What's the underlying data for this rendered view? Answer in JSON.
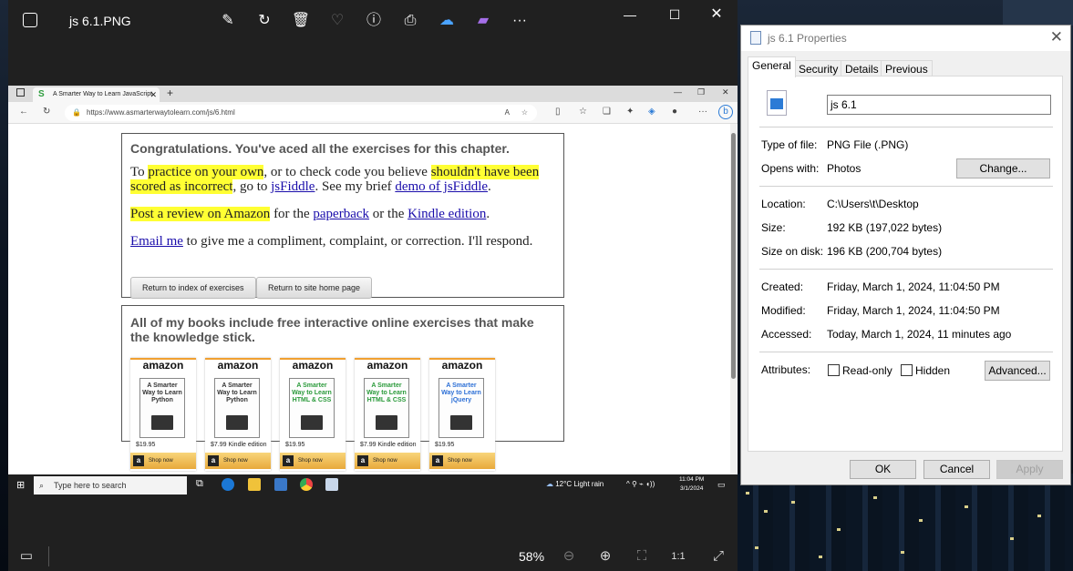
{
  "photos": {
    "title": "js 6.1.PNG",
    "zoom": "58%"
  },
  "browser": {
    "tab_title": "A Smarter Way to Learn JavaScript",
    "url": "https://www.asmarterwaytolearn.com/js/6.html"
  },
  "page": {
    "heading": "Congratulations. You've aced all the exercises for this chapter.",
    "p1": {
      "to": "To ",
      "hl1": "practice on your own",
      "mid": ", or to check code you believe ",
      "hl2": "shouldn't have been scored as incorrect",
      "go": ", go to ",
      "link1": "jsFiddle",
      "brief": ". See my brief ",
      "link2": "demo of jsFiddle",
      "end": "."
    },
    "p2": {
      "hl": "Post a review on Amazon",
      "for": " for the ",
      "link1": "paperback",
      "or": " or the ",
      "link2": "Kindle edition",
      "end": "."
    },
    "p3": {
      "link": "Email me",
      "rest": " to give me a compliment, complaint, or correction. I'll respond."
    },
    "btn_index": "Return to index of exercises",
    "btn_home": "Return to site home page",
    "books_heading": "All of my books include free interactive online exercises that make the knowledge stick.",
    "books": [
      {
        "brand": "amazon",
        "title": "A Smarter Way to Learn Python",
        "price": "$19.95",
        "shop": "Shop now",
        "color": "#333333"
      },
      {
        "brand": "amazon",
        "title": "A Smarter Way to Learn Python",
        "price": "$7.99 Kindle edition",
        "shop": "Shop now",
        "color": "#333333"
      },
      {
        "brand": "amazon",
        "title": "A Smarter Way to Learn HTML & CSS",
        "price": "$19.95",
        "shop": "Shop now",
        "color": "#2a9a3a"
      },
      {
        "brand": "amazon",
        "title": "A Smarter Way to Learn HTML & CSS",
        "price": "$7.99 Kindle edition",
        "shop": "Shop now",
        "color": "#2a9a3a"
      },
      {
        "brand": "amazon",
        "title": "A Smarter Way to Learn jQuery",
        "price": "$19.95",
        "shop": "Shop now",
        "color": "#2c6fd6"
      }
    ]
  },
  "inner_taskbar": {
    "search_placeholder": "Type here to search",
    "weather": "12°C  Light rain",
    "time": "11:04 PM",
    "date": "3/1/2024"
  },
  "dialog": {
    "title": "js 6.1 Properties",
    "tabs": [
      "General",
      "Security",
      "Details",
      "Previous Versions"
    ],
    "file_name": "js 6.1",
    "type_label": "Type of file:",
    "type_value": "PNG File (.PNG)",
    "opens_label": "Opens with:",
    "opens_value": "Photos",
    "change_button": "Change...",
    "location_label": "Location:",
    "location_value": "C:\\Users\\t\\Desktop",
    "size_label": "Size:",
    "size_value": "192 KB (197,022 bytes)",
    "sizedisk_label": "Size on disk:",
    "sizedisk_value": "196 KB (200,704 bytes)",
    "created_label": "Created:",
    "created_value": "Friday, March 1, 2024, 11:04:50 PM",
    "modified_label": "Modified:",
    "modified_value": "Friday, March 1, 2024, 11:04:50 PM",
    "accessed_label": "Accessed:",
    "accessed_value": "Today, March 1, 2024, 11 minutes ago",
    "attributes_label": "Attributes:",
    "readonly_label": "Read-only",
    "hidden_label": "Hidden",
    "advanced_button": "Advanced...",
    "ok": "OK",
    "cancel": "Cancel",
    "apply": "Apply"
  }
}
